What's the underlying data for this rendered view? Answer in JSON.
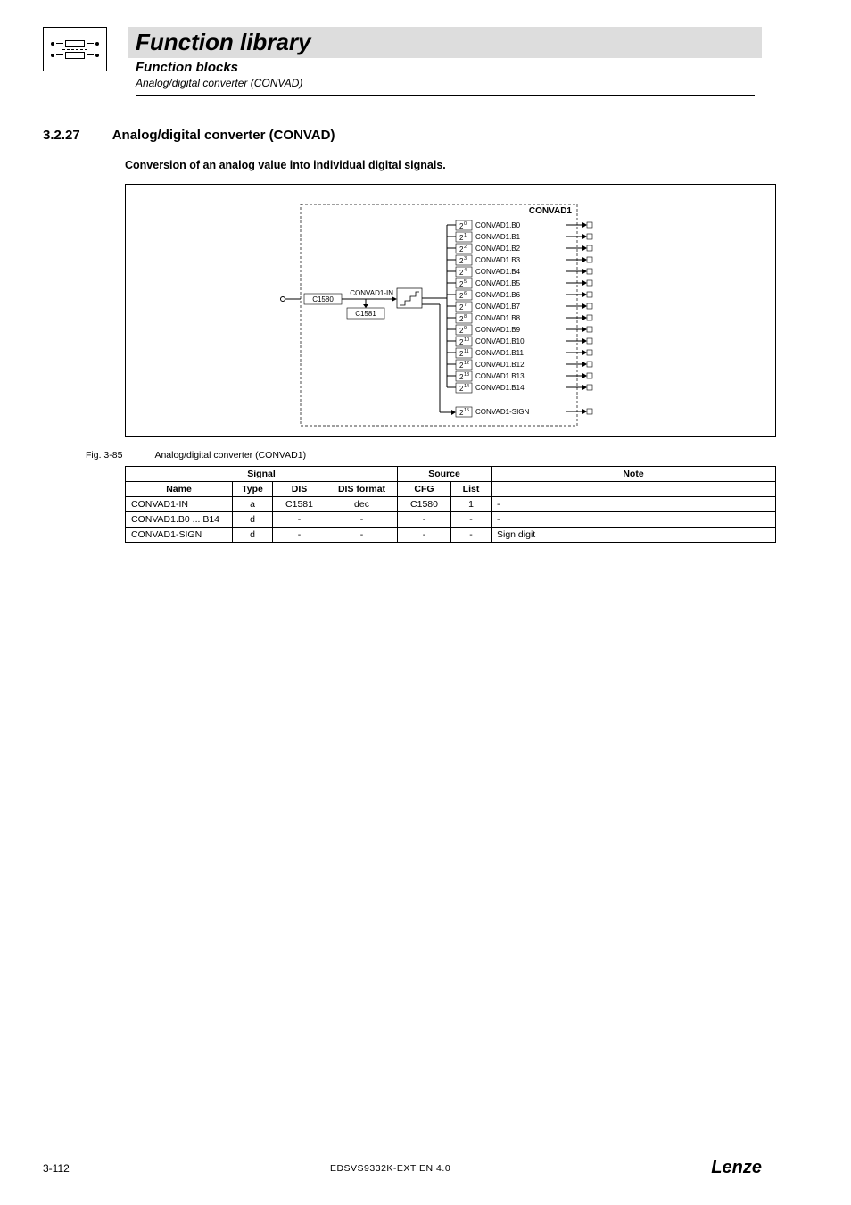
{
  "header": {
    "title": "Function library",
    "subtitle1": "Function blocks",
    "subtitle2": "Analog/digital converter (CONVAD)"
  },
  "section": {
    "number": "3.2.27",
    "title": "Analog/digital converter (CONVAD)",
    "desc": "Conversion of an analog value into individual digital signals."
  },
  "diagram": {
    "block_name": "CONVAD1",
    "input_label": "CONVAD1-IN",
    "box_top": "C1580",
    "box_bottom": "C1581",
    "bits": [
      {
        "exp": "0",
        "name": "CONVAD1.B0"
      },
      {
        "exp": "1",
        "name": "CONVAD1.B1"
      },
      {
        "exp": "2",
        "name": "CONVAD1.B2"
      },
      {
        "exp": "3",
        "name": "CONVAD1.B3"
      },
      {
        "exp": "4",
        "name": "CONVAD1.B4"
      },
      {
        "exp": "5",
        "name": "CONVAD1.B5"
      },
      {
        "exp": "6",
        "name": "CONVAD1.B6"
      },
      {
        "exp": "7",
        "name": "CONVAD1.B7"
      },
      {
        "exp": "8",
        "name": "CONVAD1.B8"
      },
      {
        "exp": "9",
        "name": "CONVAD1.B9"
      },
      {
        "exp": "10",
        "name": "CONVAD1.B10"
      },
      {
        "exp": "11",
        "name": "CONVAD1.B11"
      },
      {
        "exp": "12",
        "name": "CONVAD1.B12"
      },
      {
        "exp": "13",
        "name": "CONVAD1.B13"
      },
      {
        "exp": "14",
        "name": "CONVAD1.B14"
      }
    ],
    "sign_exp": "15",
    "sign_name": "CONVAD1-SIGN"
  },
  "figure": {
    "tag": "Fig. 3-85",
    "caption": "Analog/digital converter (CONVAD1)"
  },
  "table": {
    "head_signal": "Signal",
    "head_source": "Source",
    "head_note": "Note",
    "head_name": "Name",
    "head_type": "Type",
    "head_dis": "DIS",
    "head_disfmt": "DIS format",
    "head_cfg": "CFG",
    "head_list": "List",
    "rows": [
      {
        "name": "CONVAD1-IN",
        "type": "a",
        "dis": "C1581",
        "disfmt": "dec",
        "cfg": "C1580",
        "list": "1",
        "note": "-"
      },
      {
        "name": "CONVAD1.B0 ... B14",
        "type": "d",
        "dis": "-",
        "disfmt": "-",
        "cfg": "-",
        "list": "-",
        "note": "-"
      },
      {
        "name": "CONVAD1-SIGN",
        "type": "d",
        "dis": "-",
        "disfmt": "-",
        "cfg": "-",
        "list": "-",
        "note": "Sign digit"
      }
    ]
  },
  "footer": {
    "left": "3-112",
    "center": "EDSVS9332K-EXT EN 4.0",
    "brand": "Lenze"
  }
}
